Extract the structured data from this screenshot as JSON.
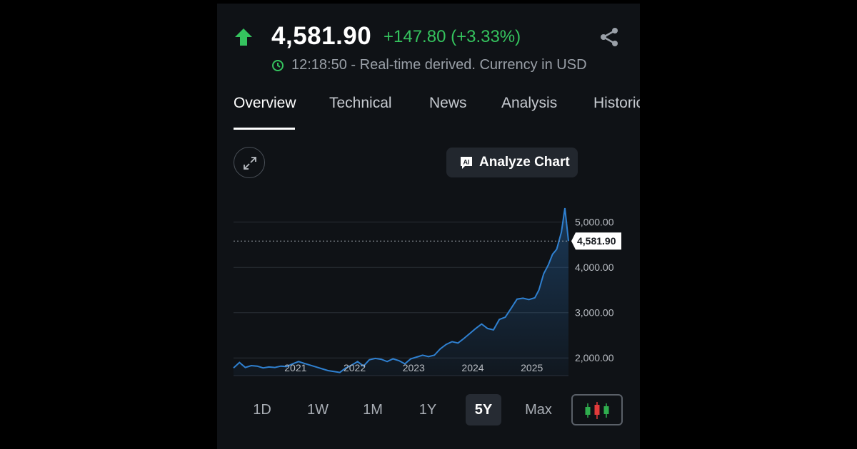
{
  "quote": {
    "price": "4,581.90",
    "change": "+147.80 (+3.33%)",
    "meta": "12:18:50 - Real-time derived. Currency in USD"
  },
  "tabs": [
    "Overview",
    "Technical",
    "News",
    "Analysis",
    "Historic"
  ],
  "active_tab": "Overview",
  "actions": {
    "analyze_chart": "Analyze Chart"
  },
  "colors": {
    "up": "#35c35e",
    "line": "#2f80d0",
    "background": "#0f1216"
  },
  "periods": [
    "1D",
    "1W",
    "1M",
    "1Y",
    "5Y",
    "Max"
  ],
  "active_period": "5Y",
  "chart_data": {
    "type": "area",
    "x_ticks": [
      "2021",
      "2022",
      "2023",
      "2024",
      "2025"
    ],
    "y_ticks": [
      "2,000.00",
      "3,000.00",
      "4,000.00",
      "5,000.00"
    ],
    "y_tick_values": [
      2000,
      3000,
      4000,
      5000
    ],
    "last_value_label": "4,581.90",
    "last_value": 4581.9,
    "ylim": [
      1610,
      5420
    ],
    "grid": true,
    "series": [
      {
        "x": [
          2020.45,
          2020.55,
          2020.65,
          2020.75,
          2020.85,
          2020.95,
          2021.05,
          2021.15,
          2021.25,
          2021.35,
          2021.45,
          2021.55,
          2021.65,
          2021.75,
          2021.85,
          2021.95,
          2022.05,
          2022.15,
          2022.25,
          2022.35,
          2022.45,
          2022.55,
          2022.65,
          2022.75,
          2022.85,
          2022.95,
          2023.05,
          2023.15,
          2023.25,
          2023.35,
          2023.45,
          2023.55,
          2023.65,
          2023.75,
          2023.85,
          2023.95,
          2024.05,
          2024.15,
          2024.25,
          2024.35,
          2024.45,
          2024.55,
          2024.65,
          2024.75,
          2024.85,
          2024.95,
          2025.05,
          2025.15,
          2025.25,
          2025.35,
          2025.45
        ],
        "y": [
          1780,
          1900,
          1790,
          1830,
          1820,
          1780,
          1800,
          1790,
          1820,
          1810,
          1870,
          1920,
          1880,
          1840,
          1800,
          1760,
          1720,
          1700,
          1680,
          1780,
          1840,
          1920,
          1820,
          1960,
          1990,
          1970,
          1920,
          1980,
          1940,
          1870,
          1980,
          2020,
          2060,
          2030,
          2060,
          2200,
          2300,
          2360,
          2330,
          2430,
          2540,
          2650,
          2750,
          2650,
          2620,
          2850,
          2900,
          3100,
          3300,
          3320,
          3290
        ],
        "y_tail_x": [
          2025.55,
          2025.62,
          2025.7,
          2025.78,
          2025.85,
          2025.92,
          2026.0,
          2026.06,
          2026.12
        ],
        "y_tail": [
          3330,
          3500,
          3860,
          4060,
          4290,
          4400,
          4780,
          5310,
          4581.9
        ]
      }
    ]
  }
}
